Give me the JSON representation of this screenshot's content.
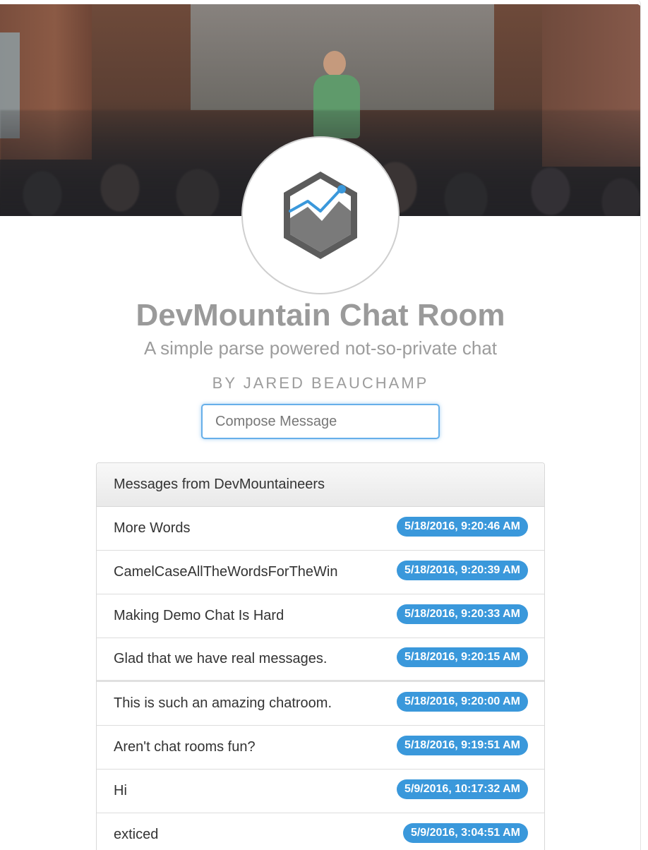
{
  "header": {
    "title": "DevMountain Chat Room",
    "subtitle": "A simple parse powered not-so-private chat",
    "byline": "BY JARED BEAUCHAMP",
    "logo_icon": "mountain-chart-hexagon-icon"
  },
  "compose": {
    "placeholder": "Compose Message",
    "value": ""
  },
  "messages_panel": {
    "heading": "Messages from DevMountaineers",
    "badge_color": "#3a98db",
    "messages": [
      {
        "text": "More Words",
        "timestamp": "5/18/2016, 9:20:46 AM"
      },
      {
        "text": "CamelCaseAllTheWordsForTheWin",
        "timestamp": "5/18/2016, 9:20:39 AM"
      },
      {
        "text": "Making Demo Chat Is Hard",
        "timestamp": "5/18/2016, 9:20:33 AM"
      },
      {
        "text": "Glad that we have real messages.",
        "timestamp": "5/18/2016, 9:20:15 AM"
      },
      {
        "text": "This is such an amazing chatroom.",
        "timestamp": "5/18/2016, 9:20:00 AM"
      },
      {
        "text": "Aren't chat rooms fun?",
        "timestamp": "5/18/2016, 9:19:51 AM"
      },
      {
        "text": "Hi",
        "timestamp": "5/9/2016, 10:17:32 AM"
      },
      {
        "text": "exticed",
        "timestamp": "5/9/2016, 3:04:51 AM"
      }
    ]
  }
}
